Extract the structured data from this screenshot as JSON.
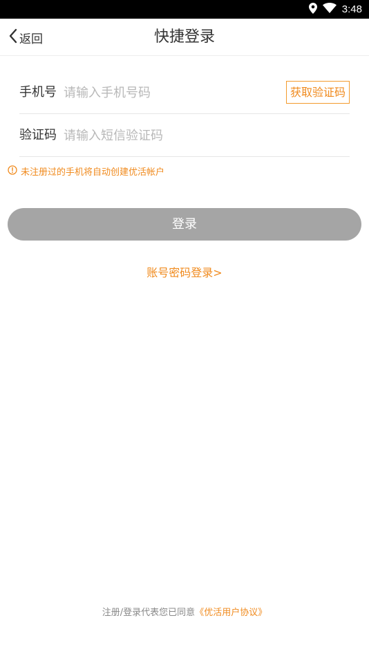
{
  "status_bar": {
    "time": "3:48",
    "icons": [
      "location-icon",
      "wifi-icon"
    ]
  },
  "nav": {
    "back_label": "返回",
    "title": "快捷登录"
  },
  "form": {
    "phone": {
      "label": "手机号",
      "placeholder": "请输入手机号码",
      "value": ""
    },
    "get_code_label": "获取验证码",
    "code": {
      "label": "验证码",
      "placeholder": "请输入短信验证码",
      "value": ""
    }
  },
  "hint": {
    "icon": "info-icon",
    "text": "未注册过的手机将自动创建优活帐户"
  },
  "login_button": "登录",
  "password_login_link": "账号密码登录>",
  "footer": {
    "prefix": "注册/登录代表您已同意",
    "agreement": "《优活用户协议》"
  },
  "colors": {
    "accent": "#f08a1d",
    "button_disabled": "#a5a5a5",
    "status_bar": "#000000"
  }
}
